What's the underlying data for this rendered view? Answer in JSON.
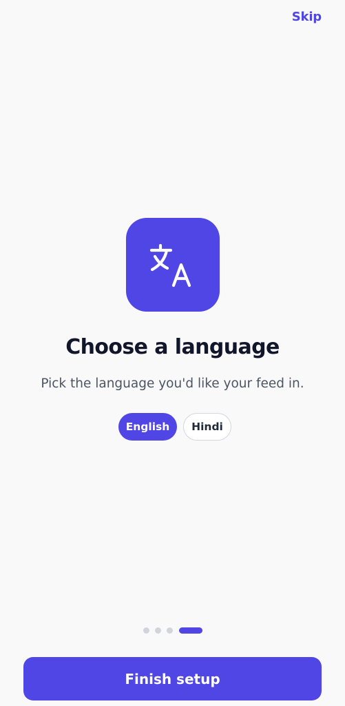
{
  "header": {
    "skip_label": "Skip"
  },
  "onboarding": {
    "icon": "translate-icon",
    "title": "Choose a language",
    "subtitle": "Pick the language you'd like your feed in."
  },
  "languages": {
    "options": [
      {
        "label": "English",
        "selected": true
      },
      {
        "label": "Hindi",
        "selected": false
      }
    ]
  },
  "pager": {
    "total_pages": 4,
    "current_page": 4
  },
  "footer": {
    "finish_label": "Finish setup"
  },
  "colors": {
    "accent": "#4f46e5",
    "background": "#f9f9fa",
    "title_text": "#12162b",
    "body_text": "#4b5563",
    "inactive_dot": "#d1d5db"
  }
}
